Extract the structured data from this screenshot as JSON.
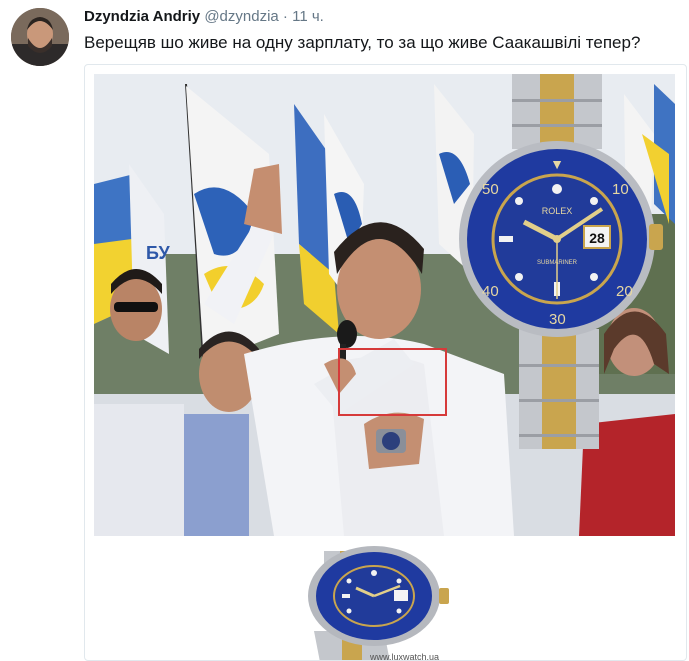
{
  "tweet": {
    "author_name": "Dzyndzia Andriy",
    "handle": "@dzyndzia",
    "separator": "·",
    "time": "11 ч.",
    "text": "Верещяв  шо живе на одну зарплату, то за що живе Саакашвілі тепер?"
  },
  "media": {
    "watch_dial_brand": "ROLEX",
    "watch_dial_model": "SUBMARINER",
    "watch_date": "28",
    "bezel_numbers": [
      "10",
      "20",
      "30",
      "40",
      "50"
    ],
    "watermark": "www.luxwatch.ua",
    "flag_text": "БУ"
  },
  "colors": {
    "name_text": "#14171a",
    "meta_text": "#657786",
    "highlight_box": "#d63a3a",
    "watch_blue": "#1f3aa0",
    "gold": "#c9a54e",
    "steel": "#c4c7cc"
  }
}
